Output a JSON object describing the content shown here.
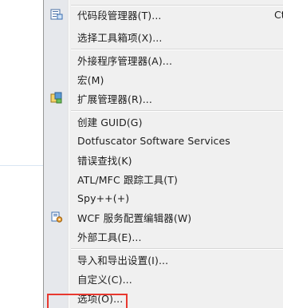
{
  "menu": {
    "items": [
      {
        "label": "代码段管理器(T)...",
        "shortcut": "Ct",
        "icon": "snippets-icon"
      },
      {
        "label": "选择工具箱项(X)...",
        "shortcut": "",
        "icon": ""
      },
      {
        "label": "外接程序管理器(A)...",
        "shortcut": "",
        "icon": ""
      },
      {
        "label": "宏(M)",
        "shortcut": "",
        "icon": ""
      },
      {
        "label": "扩展管理器(R)...",
        "shortcut": "",
        "icon": "extension-manager-icon"
      },
      {
        "label": "创建 GUID(G)",
        "shortcut": "",
        "icon": ""
      },
      {
        "label": "Dotfuscator Software Services",
        "shortcut": "",
        "icon": ""
      },
      {
        "label": "错误查找(K)",
        "shortcut": "",
        "icon": ""
      },
      {
        "label": "ATL/MFC 跟踪工具(T)",
        "shortcut": "",
        "icon": ""
      },
      {
        "label": "Spy++(+)",
        "shortcut": "",
        "icon": ""
      },
      {
        "label": "WCF 服务配置编辑器(W)",
        "shortcut": "",
        "icon": "wcf-config-icon"
      },
      {
        "label": "外部工具(E)...",
        "shortcut": "",
        "icon": ""
      },
      {
        "label": "导入和导出设置(I)...",
        "shortcut": "",
        "icon": ""
      },
      {
        "label": "自定义(C)...",
        "shortcut": "",
        "icon": ""
      },
      {
        "label": "选项(O)...",
        "shortcut": "",
        "icon": ""
      }
    ]
  },
  "colors": {
    "menu_background": "#f0f0f0",
    "gutter": "#e6e8ec",
    "highlight_border": "#e8382f"
  }
}
